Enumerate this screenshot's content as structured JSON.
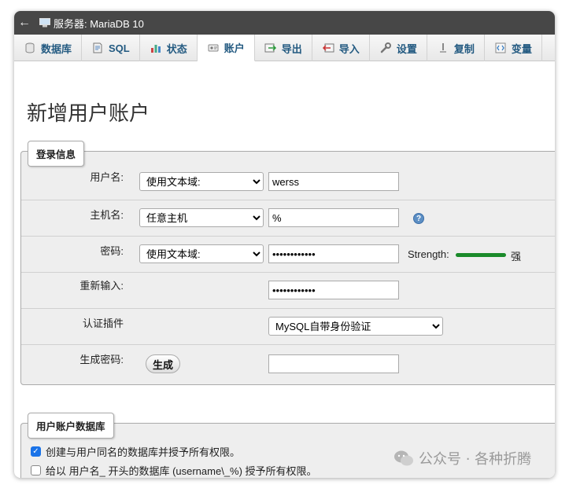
{
  "server_bar": {
    "back_icon": "back-arrow-icon",
    "title": "服务器: MariaDB 10"
  },
  "tabs": [
    {
      "label": "数据库",
      "icon": "database-icon",
      "active": false
    },
    {
      "label": "SQL",
      "icon": "sql-icon",
      "active": false
    },
    {
      "label": "状态",
      "icon": "status-icon",
      "active": false
    },
    {
      "label": "账户",
      "icon": "accounts-icon",
      "active": true
    },
    {
      "label": "导出",
      "icon": "export-icon",
      "active": false
    },
    {
      "label": "导入",
      "icon": "import-icon",
      "active": false
    },
    {
      "label": "设置",
      "icon": "settings-wrench-icon",
      "active": false
    },
    {
      "label": "复制",
      "icon": "replication-icon",
      "active": false
    },
    {
      "label": "变量",
      "icon": "variables-icon",
      "active": false
    }
  ],
  "page_title": "新增用户账户",
  "login_info": {
    "legend": "登录信息",
    "username": {
      "label": "用户名:",
      "select": "使用文本域:",
      "value": "werss"
    },
    "hostname": {
      "label": "主机名:",
      "select": "任意主机",
      "value": "%"
    },
    "password": {
      "label": "密码:",
      "select": "使用文本域:",
      "value": "••••••••••••",
      "strength_label": "Strength:",
      "strength_word": "强",
      "strength_color": "#1a8a2a"
    },
    "reenter": {
      "label": "重新输入:",
      "value": "••••••••••••"
    },
    "auth_plugin": {
      "label": "认证插件",
      "select": "MySQL自带身份验证"
    },
    "generate": {
      "label": "生成密码:",
      "button": "生成",
      "value": ""
    }
  },
  "user_db": {
    "legend": "用户账户数据库",
    "option1": {
      "label": "创建与用户同名的数据库并授予所有权限。",
      "checked": true
    },
    "option2": {
      "label": "给以 用户名_ 开头的数据库 (username\\_%) 授予所有权限。",
      "checked": false
    }
  },
  "watermark": "公众号 · 各种折腾",
  "colors": {
    "tab_text": "#235a81",
    "server_bar": "#474747",
    "fieldset_bg": "#eeeeee",
    "checkbox_checked": "#1a73e8"
  }
}
